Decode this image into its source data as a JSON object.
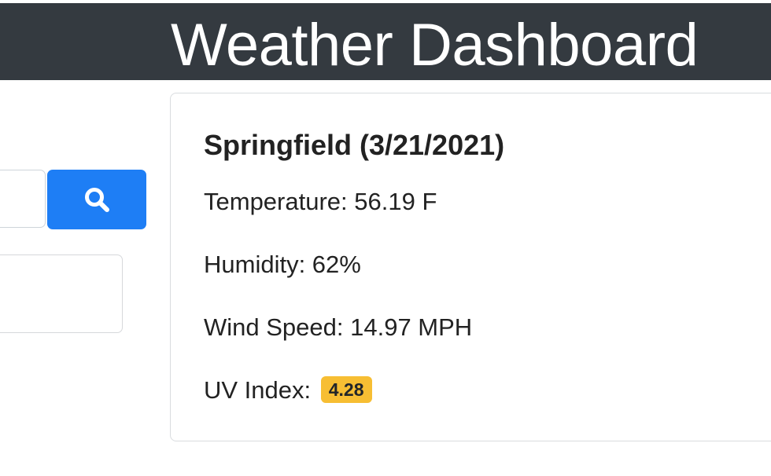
{
  "header": {
    "title": "Weather Dashboard"
  },
  "search": {
    "input_value": "",
    "placeholder": "",
    "button_icon": "search-icon"
  },
  "current_weather": {
    "city_date": "Springfield (3/21/2021)",
    "temperature": "Temperature: 56.19 F",
    "humidity": "Humidity: 62%",
    "wind_speed": "Wind Speed: 14.97 MPH",
    "uv_label": "UV Index:",
    "uv_value": "4.28"
  },
  "colors": {
    "header_bg": "#343a40",
    "primary_button": "#1e7ef5",
    "uv_moderate": "#f7be33"
  }
}
